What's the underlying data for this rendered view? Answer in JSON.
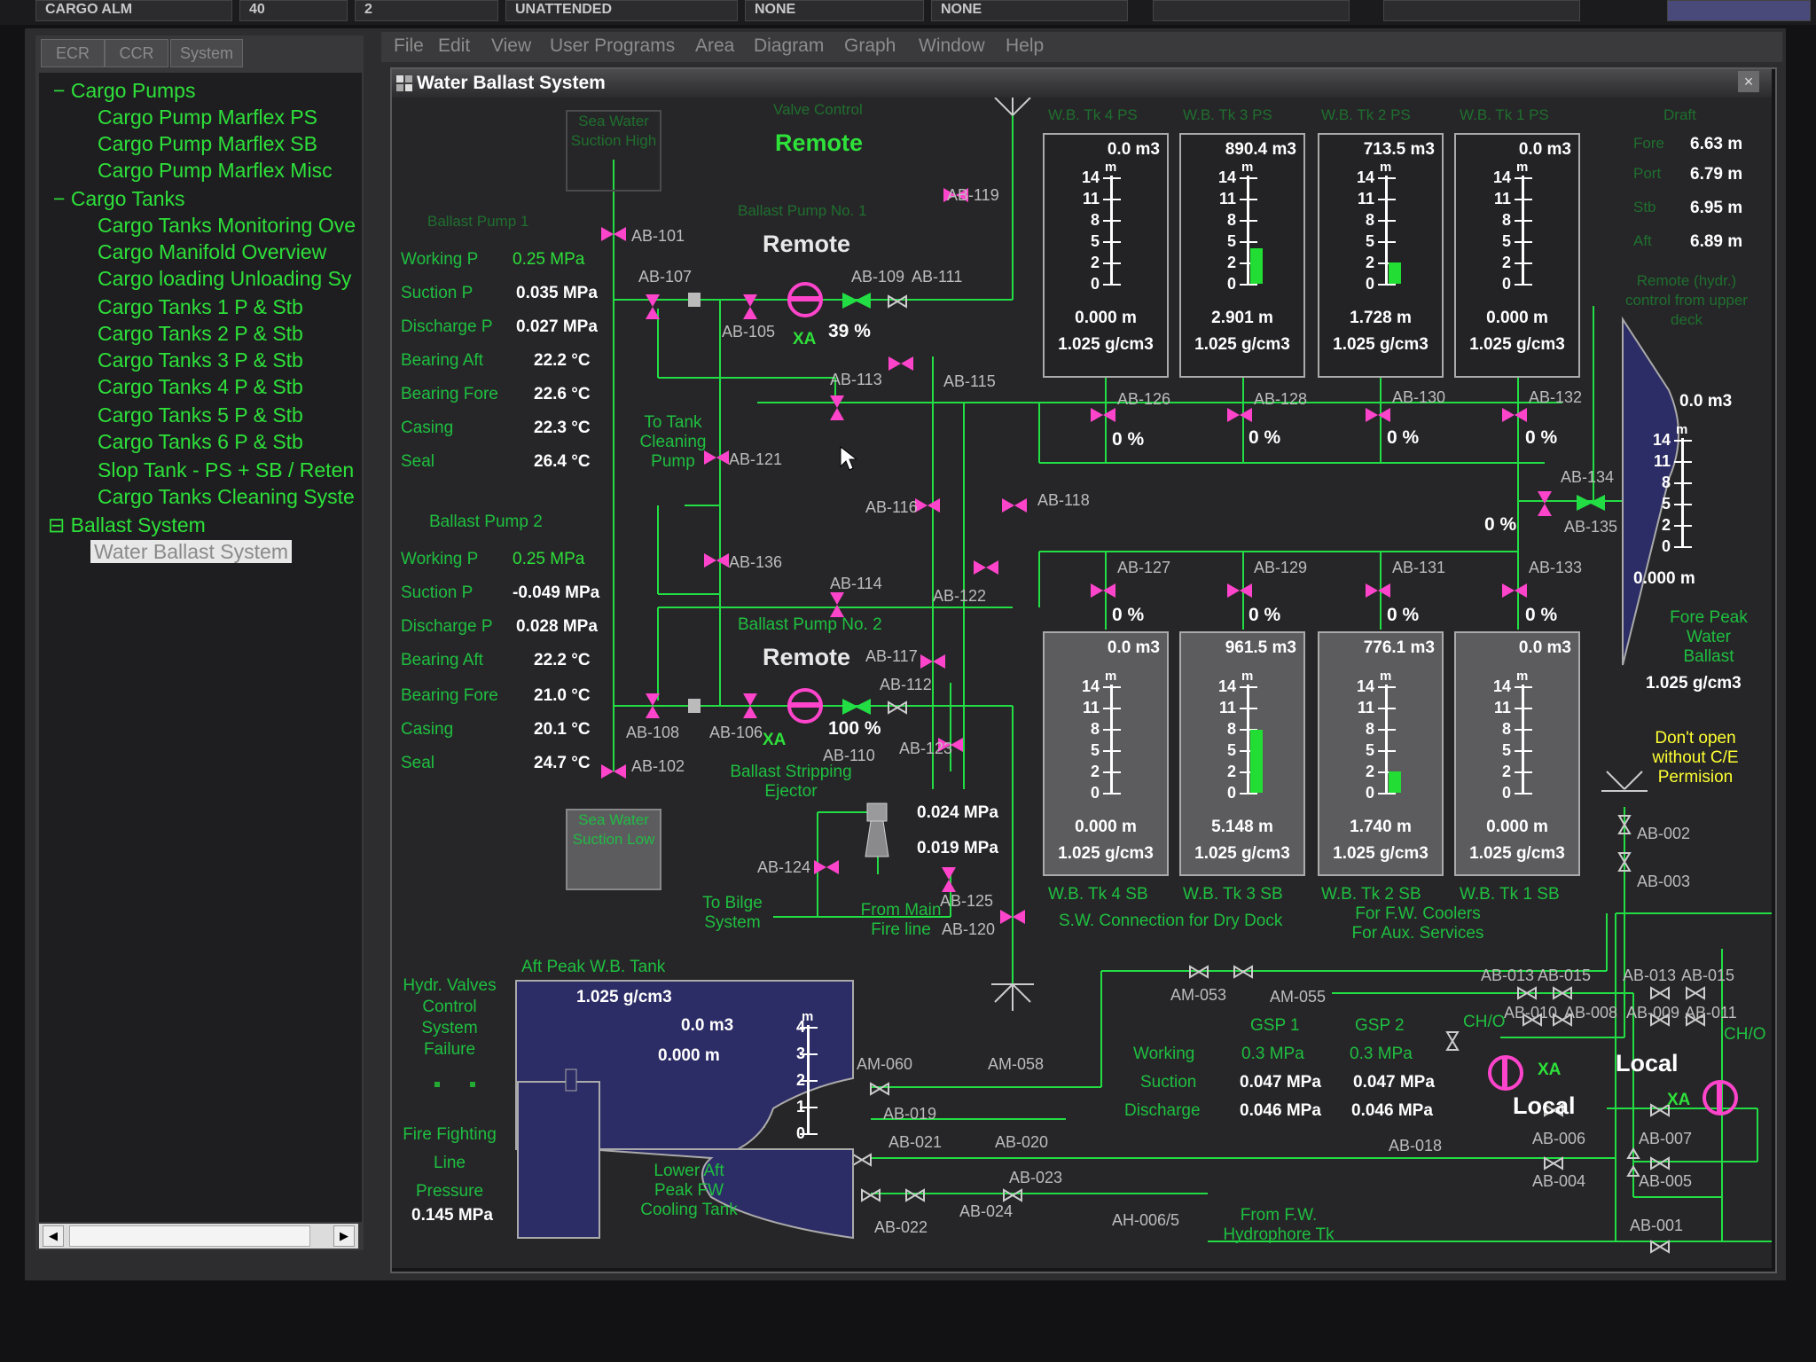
{
  "top_bar": {
    "buttons": [
      "CARGO ALM",
      "40",
      "2",
      "UNATTENDED",
      "NONE",
      "NONE",
      "",
      "",
      ""
    ]
  },
  "left_panel": {
    "tabs": [
      "ECR",
      "CCR",
      "System"
    ],
    "tree": [
      {
        "label": "Cargo Pumps",
        "prefix": "−"
      },
      {
        "label": "Cargo Pump Marflex PS"
      },
      {
        "label": "Cargo Pump Marflex SB"
      },
      {
        "label": "Cargo Pump Marflex Misc"
      },
      {
        "label": "Cargo Tanks",
        "prefix": "−"
      },
      {
        "label": "Cargo Tanks Monitoring Ove"
      },
      {
        "label": "Cargo Manifold Overview"
      },
      {
        "label": "Cargo loading Unloading Sy"
      },
      {
        "label": "Cargo Tanks 1 P & Stb"
      },
      {
        "label": "Cargo Tanks 2 P & Stb"
      },
      {
        "label": "Cargo Tanks 3 P & Stb"
      },
      {
        "label": "Cargo Tanks 4 P & Stb"
      },
      {
        "label": "Cargo Tanks 5 P & Stb"
      },
      {
        "label": "Cargo Tanks 6 P & Stb"
      },
      {
        "label": "Slop Tank - PS + SB / Reten"
      },
      {
        "label": "Cargo Tanks Cleaning Syste"
      },
      {
        "label": "Ballast System",
        "prefix": "⊟"
      },
      {
        "label": "Water Ballast System",
        "selected": true
      }
    ],
    "scroll_left": "◀",
    "scroll_right": "▶"
  },
  "menu": [
    "File",
    "Edit",
    "View",
    "User Programs",
    "Area",
    "Diagram",
    "Graph",
    "Window",
    "Help"
  ],
  "window": {
    "title": "Water Ballast System",
    "close": "×",
    "icon": "diagram-window-icon"
  },
  "diagram": {
    "valve_control": {
      "title": "Valve Control",
      "mode": "Remote"
    },
    "sea_suction_high": "Sea Water Suction High",
    "sea_suction_low": "Sea Water Suction Low",
    "pump1": {
      "title": "Ballast Pump 1",
      "mode_title": "Ballast Pump No. 1",
      "mode": "Remote",
      "rows": [
        {
          "label": "Working P",
          "value": "0.25 MPa"
        },
        {
          "label": "Suction P",
          "value": "0.035 MPa"
        },
        {
          "label": "Discharge P",
          "value": "0.027 MPa"
        },
        {
          "label": "Bearing Aft",
          "value": "22.2 °C"
        },
        {
          "label": "Bearing Fore",
          "value": "22.6 °C"
        },
        {
          "label": "Casing",
          "value": "22.3 °C"
        },
        {
          "label": "Seal",
          "value": "26.4 °C"
        }
      ],
      "xa": "XA",
      "speed": "39 %"
    },
    "pump2": {
      "title": "Ballast Pump 2",
      "mode_title": "Ballast Pump No. 2",
      "mode": "Remote",
      "rows": [
        {
          "label": "Working P",
          "value": "0.25 MPa"
        },
        {
          "label": "Suction P",
          "value": "-0.049 MPa"
        },
        {
          "label": "Discharge P",
          "value": "0.028 MPa"
        },
        {
          "label": "Bearing Aft",
          "value": "22.2 °C"
        },
        {
          "label": "Bearing Fore",
          "value": "21.0 °C"
        },
        {
          "label": "Casing",
          "value": "20.1 °C"
        },
        {
          "label": "Seal",
          "value": "24.7 °C"
        }
      ],
      "xa": "XA",
      "speed": "100 %"
    },
    "valve_tags": {
      "ab101": "AB-101",
      "ab102": "AB-102",
      "ab105": "AB-105",
      "ab106": "AB-106",
      "ab107": "AB-107",
      "ab108": "AB-108",
      "ab109": "AB-109",
      "ab110": "AB-110",
      "ab111": "AB-111",
      "ab112": "AB-112",
      "ab113": "AB-113",
      "ab114": "AB-114",
      "ab115": "AB-115",
      "ab116": "AB-116",
      "ab117": "AB-117",
      "ab118": "AB-118",
      "ab119": "AB-119",
      "ab120": "AB-120",
      "ab121": "AB-121",
      "ab122": "AB-122",
      "ab123": "AB-123",
      "ab124": "AB-124",
      "ab125": "AB-125",
      "ab126": "AB-126",
      "ab127": "AB-127",
      "ab128": "AB-128",
      "ab129": "AB-129",
      "ab130": "AB-130",
      "ab131": "AB-131",
      "ab132": "AB-132",
      "ab133": "AB-133",
      "ab134": "AB-134",
      "ab135": "AB-135",
      "ab136": "AB-136"
    },
    "to_tank_cleaning": "To Tank Cleaning Pump",
    "stripping_ejector": "Ballast Stripping Ejector",
    "ejector_p1": "0.024 MPa",
    "ejector_p2": "0.019 MPa",
    "to_bilge": "To Bilge System",
    "from_fire_main": "From Main Fire line",
    "ps_tanks": [
      {
        "name": "W.B. Tk 4 PS",
        "volume": "0.0 m3",
        "level": "0.000 m",
        "density": "1.025 g/cm3",
        "valve_open": "0 %",
        "fill_m": 0.0
      },
      {
        "name": "W.B. Tk 3 PS",
        "volume": "890.4 m3",
        "level": "2.901 m",
        "density": "1.025 g/cm3",
        "valve_open": "0 %",
        "fill_m": 2.901
      },
      {
        "name": "W.B. Tk 2 PS",
        "volume": "713.5 m3",
        "level": "1.728 m",
        "density": "1.025 g/cm3",
        "valve_open": "0 %",
        "fill_m": 1.728
      },
      {
        "name": "W.B. Tk 1 PS",
        "volume": "0.0 m3",
        "level": "0.000 m",
        "density": "1.025 g/cm3",
        "valve_open": "0 %",
        "fill_m": 0.0
      }
    ],
    "sb_tanks": [
      {
        "name": "W.B. Tk 4 SB",
        "volume": "0.0 m3",
        "level": "0.000 m",
        "density": "1.025 g/cm3",
        "valve_open": "0 %",
        "fill_m": 0.0
      },
      {
        "name": "W.B. Tk 3 SB",
        "volume": "961.5 m3",
        "level": "5.148 m",
        "density": "1.025 g/cm3",
        "valve_open": "0 %",
        "fill_m": 5.148
      },
      {
        "name": "W.B. Tk 2 SB",
        "volume": "776.1 m3",
        "level": "1.740 m",
        "density": "1.025 g/cm3",
        "valve_open": "0 %",
        "fill_m": 1.74
      },
      {
        "name": "W.B. Tk 1 SB",
        "volume": "0.0 m3",
        "level": "0.000 m",
        "density": "1.025 g/cm3",
        "valve_open": "0 %",
        "fill_m": 0.0
      }
    ],
    "tank_scale": [
      "14",
      "11",
      "8",
      "5",
      "2",
      "0"
    ],
    "tank_scale_unit": "m",
    "draft": {
      "title": "Draft",
      "rows": [
        {
          "label": "Fore",
          "value": "6.63 m"
        },
        {
          "label": "Port",
          "value": "6.79 m"
        },
        {
          "label": "Stb",
          "value": "6.95 m"
        },
        {
          "label": "Aft",
          "value": "6.89 m"
        }
      ]
    },
    "remote_hydr": "Remote (hydr.) control from upper deck",
    "fore_peak": {
      "title": "Fore Peak Water Ballast",
      "volume": "0.0 m3",
      "level": "0.000 m",
      "density": "1.025 g/cm3",
      "valve_open": "0 %"
    },
    "dont_open": "Don't open without C/E Permision",
    "aft_peak": {
      "title": "Aft Peak W.B. Tank",
      "density": "1.025 g/cm3",
      "volume": "0.0 m3",
      "level": "0.000 m",
      "scale": [
        "4",
        "3",
        "2",
        "1",
        "0"
      ]
    },
    "lower_aft_peak": "Lower Aft Peak FW Cooling Tank",
    "hydr_failure": "Hydr. Valves Control System Failure",
    "fire_fighting": {
      "label": "Fire Fighting Line Pressure",
      "value": "0.145 MPa"
    },
    "sw_connection": "S.W. Connection for Dry Dock",
    "fw_coolers": "For F.W. Coolers For Aux. Services",
    "gsp": {
      "gsp1": "GSP 1",
      "gsp2": "GSP 2",
      "row_labels": [
        "Working",
        "Suction",
        "Discharge"
      ],
      "gsp1_values": [
        "0.3 MPa",
        "0.047 MPa",
        "0.046 MPa"
      ],
      "gsp2_values": [
        "0.3 MPa",
        "0.047 MPa",
        "0.046 MPa"
      ]
    },
    "local1": "Local",
    "local2": "Local",
    "cho1": "CH/O",
    "cho2": "CH/O",
    "xa_local1": "XA",
    "xa_local2": "XA",
    "from_fw": "From F.W. Hydrophore Tk",
    "misc_tags": {
      "am053": "AM-053",
      "am055": "AM-055",
      "am058": "AM-058",
      "am060": "AM-060",
      "ab019": "AB-019",
      "ab020": "AB-020",
      "ab021": "AB-021",
      "ab022": "AB-022",
      "ab023": "AB-023",
      "ab024": "AB-024",
      "ah006": "AH-006/5",
      "ab002": "AB-002",
      "ab003": "AB-003",
      "ab013a": "AB-013",
      "ab015a": "AB-015",
      "ab013b": "AB-013",
      "ab015b": "AB-015",
      "ab010": "AB-010",
      "ab008": "AB-008",
      "ab009": "AB-009",
      "ab011": "AB-011",
      "ab018": "AB-018",
      "ab006": "AB-006",
      "ab007": "AB-007",
      "ab004": "AB-004",
      "ab005": "AB-005",
      "ab001": "AB-001"
    }
  },
  "colors": {
    "pipe": "#22dd44",
    "valve_remote": "#ff44cc",
    "valve_open": "#22dd44",
    "tank_fill": "#22dd33",
    "tank_blue": "#2c2c66",
    "alarm": "#ffff33"
  }
}
